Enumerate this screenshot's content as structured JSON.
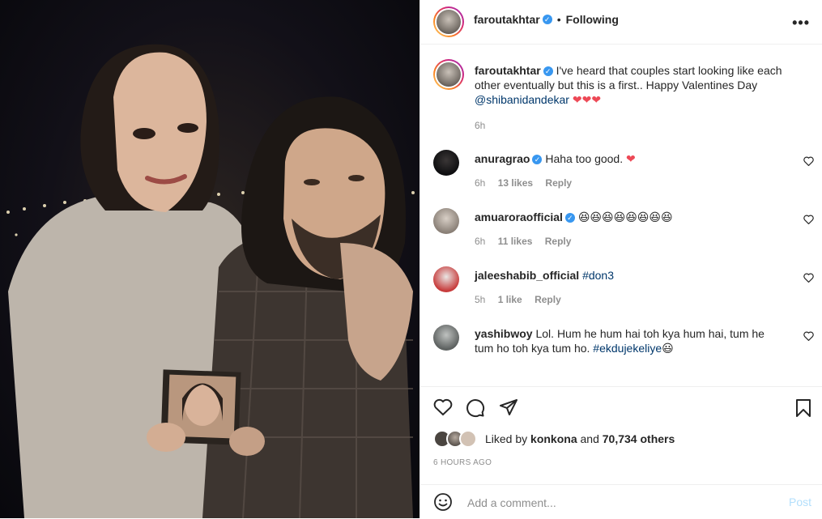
{
  "post": {
    "username": "faroutakhtar",
    "verified": true,
    "follow_dot": "•",
    "follow_status": "Following",
    "more_label": "•••"
  },
  "caption": {
    "username": "faroutakhtar",
    "text": "I've heard that couples start looking like each other eventually but this is a first.. Happy Valentines Day",
    "mention": "@shibanidandekar",
    "hearts": "❤❤❤",
    "time": "6h"
  },
  "comments": [
    {
      "username": "anuragrao",
      "verified": true,
      "text": "Haha too good.",
      "suffix": "❤",
      "time": "6h",
      "likes": "13 likes",
      "reply": "Reply"
    },
    {
      "username": "amuaroraofficial",
      "verified": true,
      "text": "",
      "suffix": "😆😆😆😆😆😆😆😆",
      "time": "6h",
      "likes": "11 likes",
      "reply": "Reply"
    },
    {
      "username": "jaleeshabib_official",
      "verified": false,
      "text": "",
      "tag": "#don3",
      "time": "5h",
      "likes": "1 like",
      "reply": "Reply"
    },
    {
      "username": "yashibwoy",
      "verified": false,
      "text": "Lol. Hum he hum hai toh kya hum hai, tum he tum ho toh kya tum ho.",
      "tag": "#ekdujekeliye",
      "suffix": "😃",
      "time": "",
      "likes": "",
      "reply": ""
    }
  ],
  "liked": {
    "prefix": "Liked by",
    "by_user": "konkona",
    "and": "and",
    "others": "70,734 others"
  },
  "timestamp": "6 HOURS AGO",
  "add_comment": {
    "placeholder": "Add a comment...",
    "post_label": "Post"
  },
  "colors": {
    "link": "#00376b",
    "verified": "#3897f0",
    "post_button_disabled": "#b2dffc",
    "muted": "#8e8e8e"
  },
  "icons": {
    "comment_heart": "heart-outline-icon",
    "like": "heart-outline-icon",
    "comment": "comment-bubble-icon",
    "share": "paper-plane-icon",
    "save": "bookmark-icon",
    "emoji": "smiley-icon"
  }
}
